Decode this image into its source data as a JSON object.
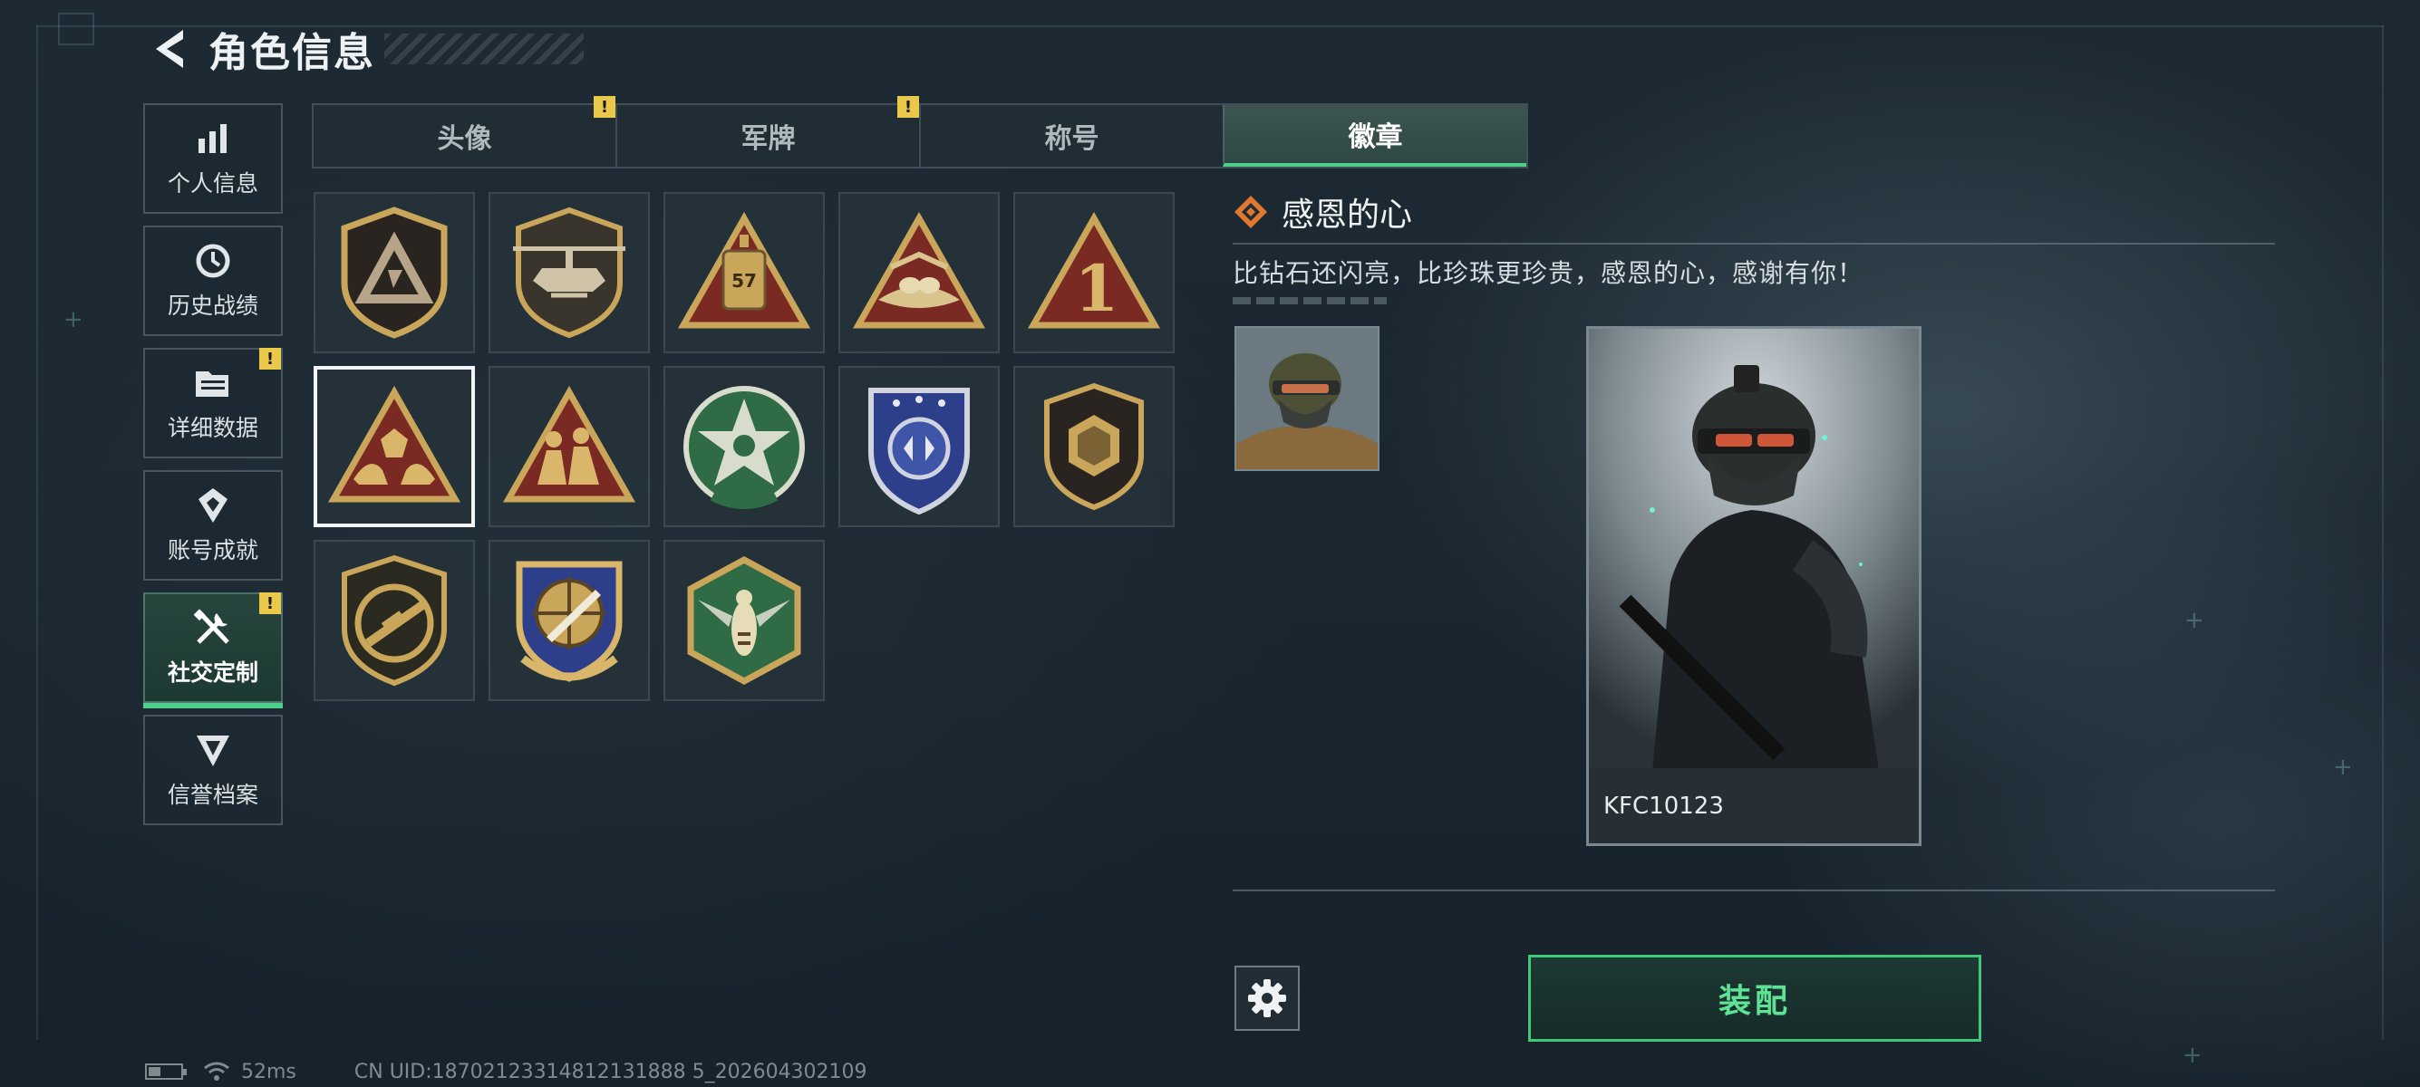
{
  "header": {
    "title": "角色信息"
  },
  "sidebar": {
    "items": [
      {
        "label": "个人信息",
        "icon": "bar-chart-icon",
        "active": false,
        "alert": false
      },
      {
        "label": "历史战绩",
        "icon": "history-clock-icon",
        "active": false,
        "alert": false
      },
      {
        "label": "详细数据",
        "icon": "folder-icon",
        "active": false,
        "alert": true
      },
      {
        "label": "账号成就",
        "icon": "achievement-icon",
        "active": false,
        "alert": false
      },
      {
        "label": "社交定制",
        "icon": "tools-icon",
        "active": true,
        "alert": true
      },
      {
        "label": "信誉档案",
        "icon": "credit-emblem-icon",
        "active": false,
        "alert": false
      }
    ]
  },
  "tabs": [
    {
      "label": "头像",
      "active": false,
      "alert": true
    },
    {
      "label": "军牌",
      "active": false,
      "alert": true
    },
    {
      "label": "称号",
      "active": false,
      "alert": false
    },
    {
      "label": "徽章",
      "active": true,
      "alert": false
    }
  ],
  "alert_mark": "!",
  "badges": [
    {
      "icon": "triangle-a-shield-badge-icon"
    },
    {
      "icon": "helicopter-shield-badge-icon"
    },
    {
      "icon": "dogtag-57-triangle-badge-icon"
    },
    {
      "icon": "eagle-nest-triangle-badge-icon"
    },
    {
      "icon": "number-one-triangle-badge-icon"
    },
    {
      "icon": "hands-diamond-triangle-badge-icon",
      "selected": true
    },
    {
      "icon": "soldiers-triangle-badge-icon"
    },
    {
      "icon": "green-star-badge-icon"
    },
    {
      "icon": "blue-wings-shield-badge-icon"
    },
    {
      "icon": "hexagon-shield-badge-icon"
    },
    {
      "icon": "rifle-shield-badge-icon"
    },
    {
      "icon": "crosshair-knife-badge-icon"
    },
    {
      "icon": "hornet-hexagon-badge-icon"
    }
  ],
  "detail": {
    "title": "感恩的心",
    "description": "比钻石还闪亮，比珍珠更珍贵，感恩的心，感谢有你！",
    "player_name": "KFC10123"
  },
  "actions": {
    "equip_label": "装配"
  },
  "status": {
    "ping": "52ms",
    "uid": "CN UID:18702123314812131888 5_202604302109",
    "battery_fraction": 0.35
  },
  "colors": {
    "accent": "#4fd08a",
    "alert": "#e9c84a",
    "badge_gold": "#c9a65a",
    "badge_red": "#8a2a24",
    "badge_green": "#2f6b45",
    "badge_blue": "#2d3f8a"
  }
}
